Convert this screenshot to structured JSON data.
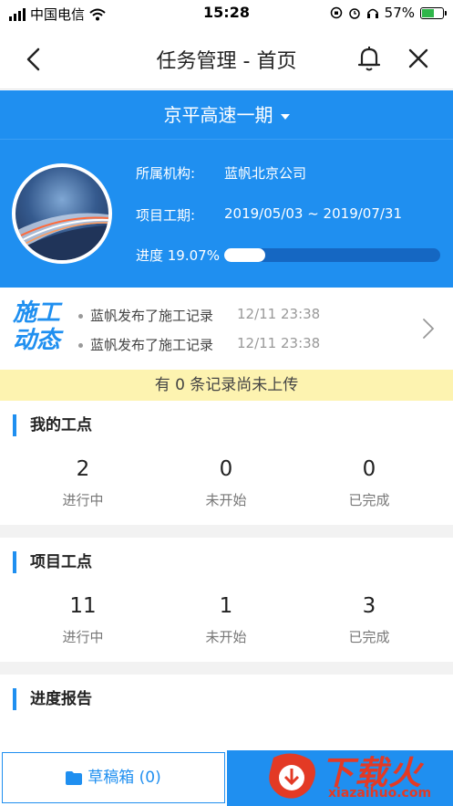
{
  "status_bar": {
    "carrier": "中国电信",
    "time": "15:28",
    "battery": "57%",
    "battery_level": 0.57
  },
  "nav": {
    "title": "任务管理 - 首页"
  },
  "project": {
    "name": "京平高速一期",
    "org_label": "所属机构:",
    "org_value": "蓝帆北京公司",
    "period_label": "项目工期:",
    "period_value": "2019/05/03 ~ 2019/07/31",
    "progress_label": "进度 19.07%",
    "progress_value": 19.07
  },
  "activity": {
    "logo_line1": "施工",
    "logo_line2": "动态",
    "items": [
      {
        "text": "蓝帆发布了施工记录",
        "time": "12/11 23:38"
      },
      {
        "text": "蓝帆发布了施工记录",
        "time": "12/11 23:38"
      }
    ]
  },
  "upload_banner": "有 0 条记录尚未上传",
  "my_points": {
    "title": "我的工点",
    "stats": [
      {
        "num": "2",
        "label": "进行中"
      },
      {
        "num": "0",
        "label": "未开始"
      },
      {
        "num": "0",
        "label": "已完成"
      }
    ]
  },
  "project_points": {
    "title": "项目工点",
    "stats": [
      {
        "num": "11",
        "label": "进行中"
      },
      {
        "num": "1",
        "label": "未开始"
      },
      {
        "num": "3",
        "label": "已完成"
      }
    ]
  },
  "progress_report": {
    "title": "进度报告"
  },
  "bottom": {
    "drafts_label": "草稿箱 (0)"
  },
  "watermark": {
    "text": "下载火",
    "url": "xiazaihuo.com"
  },
  "colors": {
    "primary": "#1f8ff0",
    "banner": "#fdf3b0",
    "watermark": "#e33a25"
  }
}
